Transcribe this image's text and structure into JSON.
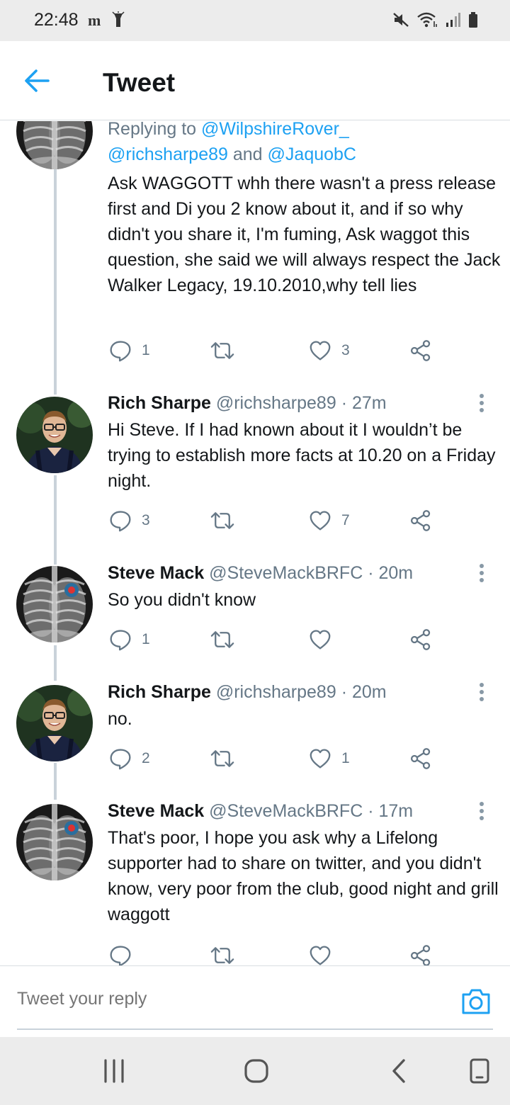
{
  "status_bar": {
    "time": "22:48",
    "left_icons": [
      "telegraph-icon",
      "torch-icon"
    ],
    "right_icons": [
      "mute-icon",
      "wifi-icon",
      "signal-icon",
      "battery-icon"
    ]
  },
  "header": {
    "title": "Tweet",
    "back_icon": "back-arrow-icon"
  },
  "colors": {
    "accent": "#1da1f2",
    "text": "#14171a",
    "muted": "#657786",
    "thread_line": "#c9d2da"
  },
  "tweets": [
    {
      "avatar": "xray-avatar",
      "reply_prefix": "Replying to ",
      "reply_handles": [
        "@WilpshireRover_",
        "@richsharpe89",
        "@JaquobC"
      ],
      "reply_and": " and ",
      "text": "Ask WAGGOTT whh there wasn't a press release first and Di you 2 know about it, and if so why didn't you share it, I'm fuming, Ask waggot this question, she said we will always respect the Jack Walker Legacy, 19.10.2010,why tell lies",
      "replies": "1",
      "retweets": "",
      "likes": "3"
    },
    {
      "avatar": "person-avatar",
      "name": "Rich Sharpe",
      "handle": "@richsharpe89",
      "time": " · 27m",
      "text": "Hi Steve. If I had known about it I wouldn’t be trying to establish more facts at 10.20 on a Friday night.",
      "replies": "3",
      "retweets": "",
      "likes": "7"
    },
    {
      "avatar": "xray-badge-avatar",
      "name": "Steve Mack",
      "handle": "@SteveMackBRFC",
      "time": " · 20m",
      "text": "So you didn't know",
      "replies": "1",
      "retweets": "",
      "likes": ""
    },
    {
      "avatar": "person-avatar",
      "name": "Rich Sharpe",
      "handle": "@richsharpe89",
      "time": " · 20m",
      "text": "no.",
      "replies": "2",
      "retweets": "",
      "likes": "1"
    },
    {
      "avatar": "xray-badge-avatar",
      "name": "Steve Mack",
      "handle": "@SteveMackBRFC",
      "time": " · 17m",
      "text": "That's poor, I hope you ask why a Lifelong supporter had to share on twitter, and you didn't know, very poor from the club, good night and grill waggott",
      "replies": "",
      "retweets": "",
      "likes": ""
    }
  ],
  "compose": {
    "placeholder": "Tweet your reply",
    "camera_icon": "camera-icon"
  },
  "nav_bar": {
    "icons": [
      "recent-apps-icon",
      "home-icon",
      "back-icon",
      "screenshot-icon"
    ]
  }
}
